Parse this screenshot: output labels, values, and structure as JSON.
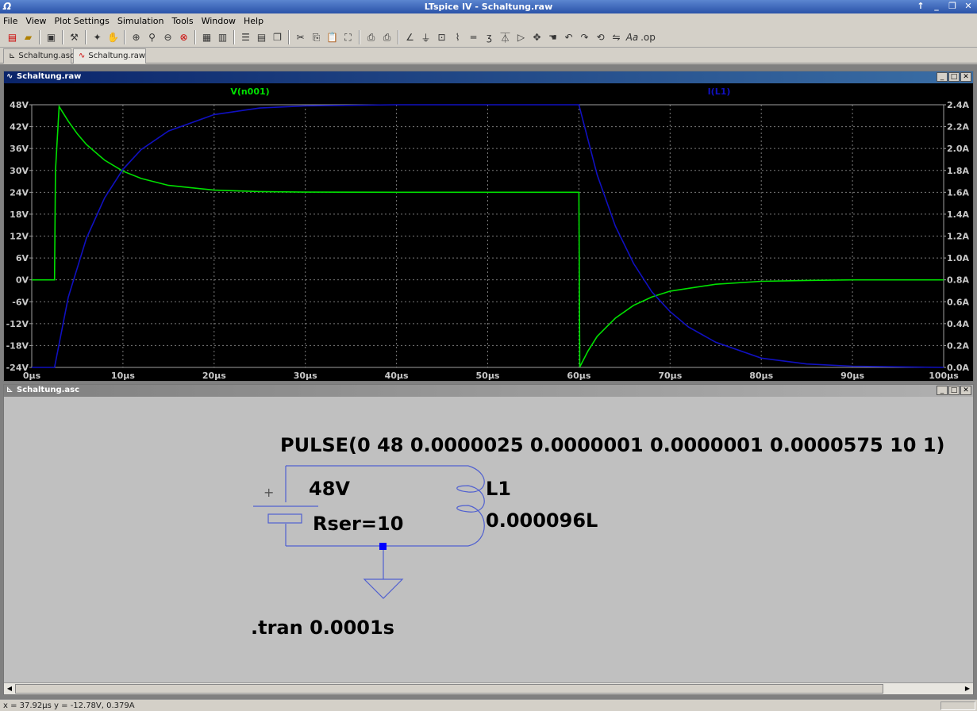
{
  "window": {
    "title": "LTspice IV - Schaltung.raw"
  },
  "menu": [
    "File",
    "View",
    "Plot Settings",
    "Simulation",
    "Tools",
    "Window",
    "Help"
  ],
  "tabs": [
    {
      "label": "Schaltung.asc",
      "active": false
    },
    {
      "label": "Schaltung.raw",
      "active": true
    }
  ],
  "waveform_window": {
    "title": "Schaltung.raw"
  },
  "schematic_window": {
    "title": "Schaltung.asc"
  },
  "status": {
    "text": "x = 37.92µs    y = -12.78V, 0.379A"
  },
  "colors": {
    "voltage_trace": "#00e000",
    "current_trace": "#1010c0",
    "plot_bg": "#000000",
    "grid": "#7a7a7a"
  },
  "chart_data": {
    "type": "line",
    "series": [
      {
        "name": "V(n001)",
        "axis": "left",
        "color": "#00e000",
        "x": [
          0,
          2.5,
          2.6,
          3,
          4,
          5,
          6,
          8,
          10,
          12,
          15,
          20,
          25,
          30,
          40,
          50,
          59.9,
          60,
          60.1,
          61,
          62,
          64,
          66,
          68,
          70,
          75,
          80,
          85,
          90,
          100
        ],
        "y": [
          0,
          0,
          30,
          47.5,
          43.5,
          40.0,
          37.1,
          32.8,
          29.8,
          27.8,
          25.9,
          24.6,
          24.2,
          24.05,
          24.0,
          24.0,
          24.0,
          24.0,
          -23.9,
          -19.5,
          -15.5,
          -10.5,
          -7.0,
          -4.7,
          -3.1,
          -1.2,
          -0.4,
          -0.15,
          0,
          0
        ]
      },
      {
        "name": "I(L1)",
        "axis": "right",
        "color": "#1010c0",
        "x": [
          0,
          2.5,
          4,
          6,
          8,
          10,
          12,
          15,
          20,
          25,
          30,
          40,
          50,
          60,
          62,
          64,
          66,
          68,
          70,
          72,
          75,
          80,
          85,
          90,
          100
        ],
        "y": [
          0,
          0,
          0.64,
          1.18,
          1.55,
          1.81,
          1.99,
          2.16,
          2.31,
          2.37,
          2.39,
          2.4,
          2.4,
          2.4,
          1.76,
          1.29,
          0.95,
          0.69,
          0.51,
          0.37,
          0.23,
          0.085,
          0.031,
          0.011,
          0
        ]
      }
    ],
    "x_ticks": [
      "0µs",
      "10µs",
      "20µs",
      "30µs",
      "40µs",
      "50µs",
      "60µs",
      "70µs",
      "80µs",
      "90µs",
      "100µs"
    ],
    "y_left_ticks": [
      "48V",
      "42V",
      "36V",
      "30V",
      "24V",
      "18V",
      "12V",
      "6V",
      "0V",
      "-6V",
      "-12V",
      "-18V",
      "-24V"
    ],
    "y_right_ticks": [
      "2.4A",
      "2.2A",
      "2.0A",
      "1.8A",
      "1.6A",
      "1.4A",
      "1.2A",
      "1.0A",
      "0.8A",
      "0.6A",
      "0.4A",
      "0.2A",
      "0.0A"
    ],
    "xlim": [
      0,
      100
    ],
    "ylim_left": [
      -24,
      48
    ],
    "ylim_right": [
      0,
      2.4
    ],
    "grid": true
  },
  "schematic": {
    "pulse_directive": "PULSE(0 48 0.0000025 0.0000001 0.0000001 0.0000575 10 1)",
    "source_value": "48V",
    "source_rser": "Rser=10",
    "inductor_name": "L1",
    "inductor_value": "0.000096L",
    "tran_directive": ".tran 0.0001s",
    "plus_sign": "+"
  }
}
